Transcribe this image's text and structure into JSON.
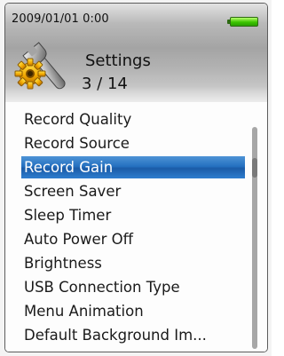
{
  "status_bar": {
    "datetime": "2009/01/01   0:00",
    "battery_icon": "battery-full-icon",
    "battery_color": "#3cc400"
  },
  "header": {
    "icon": "settings-gear-wrench-icon",
    "title": "Settings",
    "counter": "3 / 14"
  },
  "menu": {
    "items": [
      {
        "label": "Record Quality",
        "selected": false
      },
      {
        "label": "Record Source",
        "selected": false
      },
      {
        "label": "Record Gain",
        "selected": true
      },
      {
        "label": "Screen Saver",
        "selected": false
      },
      {
        "label": "Sleep Timer",
        "selected": false
      },
      {
        "label": "Auto Power Off",
        "selected": false
      },
      {
        "label": "Brightness",
        "selected": false
      },
      {
        "label": "USB Connection Type",
        "selected": false
      },
      {
        "label": "Menu Animation",
        "selected": false
      },
      {
        "label": "Default Background Im...",
        "selected": false
      }
    ],
    "selection_color": "#2571c0"
  },
  "scrollbar": {
    "position": 3,
    "total": 14
  }
}
